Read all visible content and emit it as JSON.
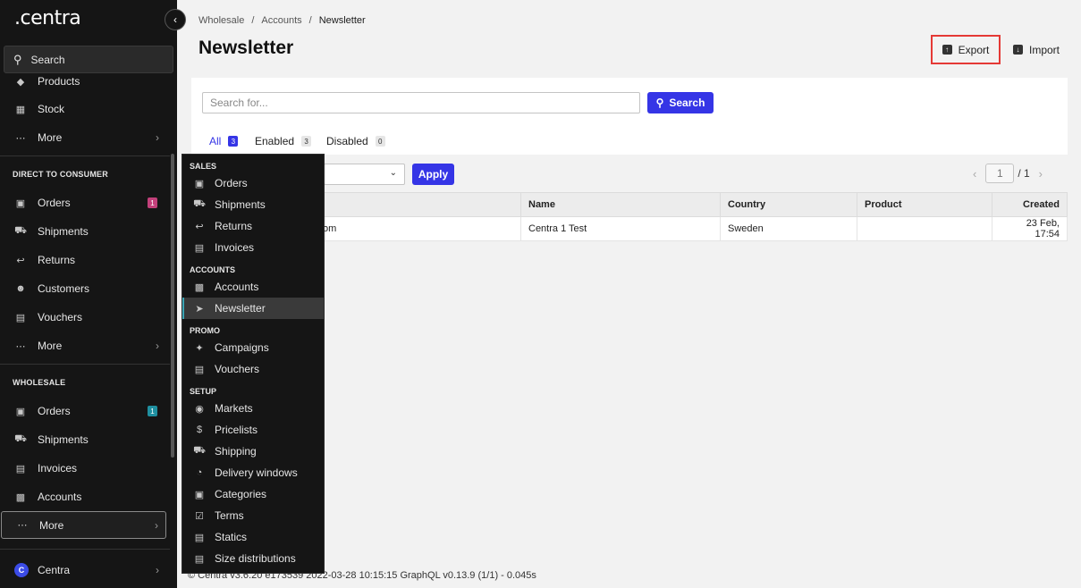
{
  "app": {
    "logo": ".centra"
  },
  "sidebar": {
    "search_label": "Search",
    "top_items": [
      {
        "label": "Products",
        "icon": "tag-icon"
      },
      {
        "label": "Stock",
        "icon": "stock-icon"
      },
      {
        "label": "More",
        "icon": "dots-icon"
      }
    ],
    "dtc_section": "DIRECT TO CONSUMER",
    "dtc_items": [
      {
        "label": "Orders",
        "badge": "1"
      },
      {
        "label": "Shipments"
      },
      {
        "label": "Returns"
      },
      {
        "label": "Customers"
      },
      {
        "label": "Vouchers"
      },
      {
        "label": "More"
      }
    ],
    "wholesale_section": "WHOLESALE",
    "wholesale_items": [
      {
        "label": "Orders",
        "badge": "1"
      },
      {
        "label": "Shipments"
      },
      {
        "label": "Invoices"
      },
      {
        "label": "Accounts"
      },
      {
        "label": "More"
      }
    ],
    "user": {
      "avatar": "C",
      "name": "Centra"
    }
  },
  "flyout": {
    "sections": {
      "sales": "SALES",
      "accounts": "ACCOUNTS",
      "promo": "PROMO",
      "setup": "SETUP"
    },
    "sales": [
      "Orders",
      "Shipments",
      "Returns",
      "Invoices"
    ],
    "accounts": [
      "Accounts",
      "Newsletter"
    ],
    "promo": [
      "Campaigns",
      "Vouchers"
    ],
    "setup": [
      "Markets",
      "Pricelists",
      "Shipping",
      "Delivery windows",
      "Categories",
      "Terms",
      "Statics",
      "Size distributions"
    ]
  },
  "main": {
    "breadcrumb": [
      "Wholesale",
      "Accounts",
      "Newsletter"
    ],
    "breadcrumb_sep": "/",
    "title": "Newsletter",
    "export_label": "Export",
    "import_label": "Import",
    "search": {
      "placeholder": "Search for...",
      "button": "Search"
    },
    "tabs": [
      {
        "label": "All",
        "count": "3"
      },
      {
        "label": "Enabled",
        "count": "3"
      },
      {
        "label": "Disabled",
        "count": "0"
      }
    ],
    "apply_label": "Apply",
    "pager": {
      "page": "1",
      "total": "/ 1"
    },
    "table": {
      "columns": [
        "",
        "Name",
        "Country",
        "Product",
        "Created"
      ],
      "rows": [
        [
          "om",
          "Centra 1 Test",
          "Sweden",
          "",
          "23 Feb, 17:54"
        ]
      ]
    }
  },
  "footer": "© Centra v3.6.20 e173539 2022-03-28 10:15:15 GraphQL v0.13.9 (1/1) - 0.045s"
}
